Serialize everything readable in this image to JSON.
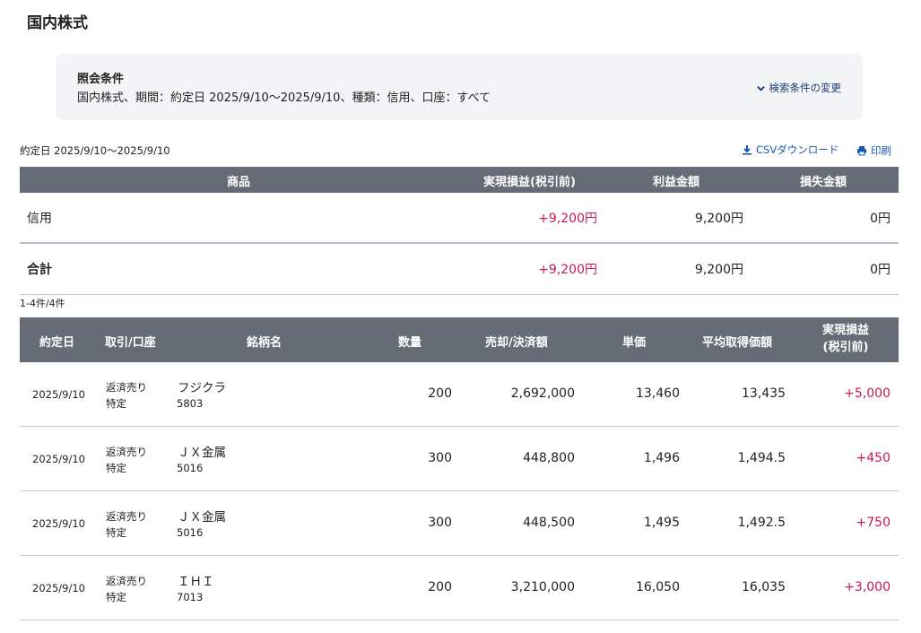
{
  "page": {
    "title": "国内株式"
  },
  "conditions": {
    "title": "照会条件",
    "text": "国内株式、期間：約定日 2025/9/10〜2025/9/10、種類：信用、口座：すべて",
    "change_label": "検索条件の変更"
  },
  "range_label": "約定日 2025/9/10〜2025/9/10",
  "actions": {
    "csv_label": "CSVダウンロード",
    "print_label": "印刷"
  },
  "summary": {
    "headers": {
      "product": "商品",
      "pl": "実現損益(税引前)",
      "profit": "利益金額",
      "loss": "損失金額"
    },
    "rows": [
      {
        "product": "信用",
        "pl": "+9,200円",
        "profit": "9,200円",
        "loss": "0円"
      },
      {
        "product": "合計",
        "pl": "+9,200円",
        "profit": "9,200円",
        "loss": "0円"
      }
    ]
  },
  "count_label": "1-4件/4件",
  "detail": {
    "headers": {
      "date": "約定日",
      "trade": "取引/口座",
      "stock": "銘柄名",
      "qty": "数量",
      "amount": "売却/決済額",
      "price": "単価",
      "avg_cost": "平均取得価額",
      "pl_line1": "実現損益",
      "pl_line2": "(税引前)"
    },
    "rows": [
      {
        "date": "2025/9/10",
        "trade": "返済売り",
        "account": "特定",
        "stock": "フジクラ",
        "code": "5803",
        "qty": "200",
        "amount": "2,692,000",
        "price": "13,460",
        "avg_cost": "13,435",
        "pl": "+5,000"
      },
      {
        "date": "2025/9/10",
        "trade": "返済売り",
        "account": "特定",
        "stock": "ＪＸ金属",
        "code": "5016",
        "qty": "300",
        "amount": "448,800",
        "price": "1,496",
        "avg_cost": "1,494.5",
        "pl": "+450"
      },
      {
        "date": "2025/9/10",
        "trade": "返済売り",
        "account": "特定",
        "stock": "ＪＸ金属",
        "code": "5016",
        "qty": "300",
        "amount": "448,500",
        "price": "1,495",
        "avg_cost": "1,492.5",
        "pl": "+750"
      },
      {
        "date": "2025/9/10",
        "trade": "返済売り",
        "account": "特定",
        "stock": "ＩＨＩ",
        "code": "7013",
        "qty": "200",
        "amount": "3,210,000",
        "price": "16,050",
        "avg_cost": "16,035",
        "pl": "+3,000"
      }
    ]
  },
  "colors": {
    "header_bg": "#666c76",
    "profit": "#c8194e",
    "link": "#1a57b4",
    "panel_bg": "#f3f4f5"
  }
}
